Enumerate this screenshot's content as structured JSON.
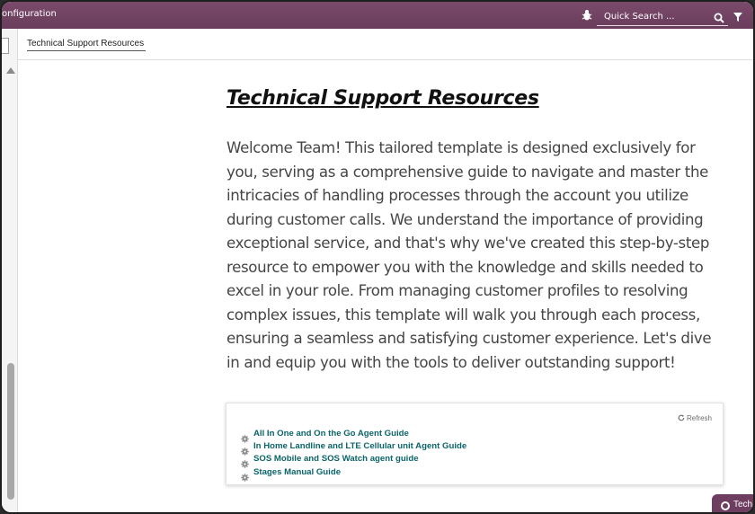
{
  "topbar": {
    "title": "onfiguration",
    "search_placeholder": "Quick Search ..."
  },
  "breadcrumb": {
    "label": "Technical Support Resources"
  },
  "main": {
    "title": "Technical Support Resources",
    "intro": "Welcome Team! This tailored template is designed exclusively for you, serving as a comprehensive guide to navigate and master the intricacies of handling processes through the account you utilize during customer calls. We understand the importance of providing exceptional service, and that's why we've created this step-by-step resource to empower you with the knowledge and skills needed to excel in your role. From managing customer profiles to resolving complex issues, this template will walk you through each process, ensuring a seamless and satisfying customer experience. Let's dive in and equip you with the tools to deliver outstanding support!"
  },
  "guides": {
    "refresh_label": "Refresh",
    "items": [
      {
        "label": "All In One and On the Go Agent Guide",
        "icon": "gear-icon"
      },
      {
        "label": "In Home Landline and LTE Cellular unit Agent Guide",
        "icon": "gear-icon"
      },
      {
        "label": "SOS Mobile and SOS Watch agent guide",
        "icon": "gear-icon"
      },
      {
        "label": "Stages Manual Guide",
        "icon": "gear-icon"
      }
    ]
  },
  "chip": {
    "label": "Tech"
  },
  "colors": {
    "topbar": "#6a3d5c",
    "link": "#0b6468",
    "body_text": "#454545"
  }
}
